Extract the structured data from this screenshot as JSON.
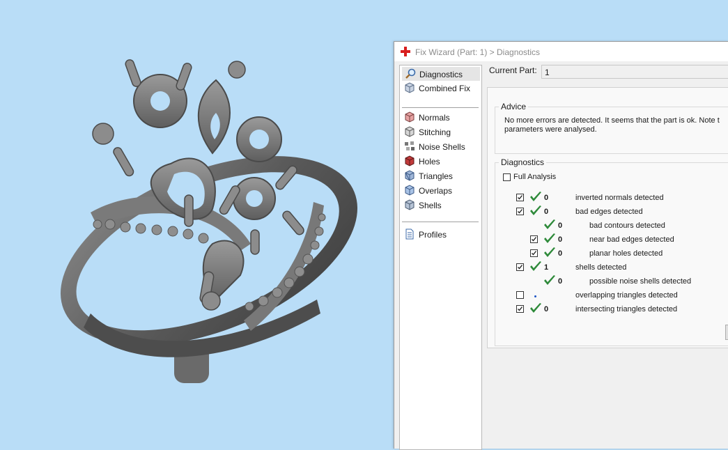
{
  "window": {
    "title": "Fix Wizard (Part: 1) > Diagnostics",
    "app_icon": "red-cross-icon"
  },
  "nav": {
    "items": [
      {
        "label": "Diagnostics",
        "icon": "magnifier-icon",
        "selected": true
      },
      {
        "label": "Combined Fix",
        "icon": "cube-icon"
      },
      {
        "label": "Normals",
        "icon": "normals-cube-icon"
      },
      {
        "label": "Stitching",
        "icon": "stitching-cube-icon"
      },
      {
        "label": "Noise Shells",
        "icon": "noise-shells-icon"
      },
      {
        "label": "Holes",
        "icon": "holes-cube-icon"
      },
      {
        "label": "Triangles",
        "icon": "triangles-cube-icon"
      },
      {
        "label": "Overlaps",
        "icon": "overlaps-cube-icon"
      },
      {
        "label": "Shells",
        "icon": "shells-cube-icon"
      },
      {
        "label": "Profiles",
        "icon": "document-icon"
      }
    ]
  },
  "current_part": {
    "label": "Current Part:",
    "value": "1"
  },
  "advice": {
    "legend": "Advice",
    "line1": "No more errors are detected. It seems that the part is ok. Note t",
    "line2": "parameters were analysed."
  },
  "diagnostics": {
    "legend": "Diagnostics",
    "full_analysis_label": "Full Analysis",
    "full_analysis_checked": false,
    "rows": [
      {
        "checkbox": true,
        "checked": true,
        "status": "ok",
        "count": "0",
        "label": "inverted normals detected",
        "indent": 0
      },
      {
        "checkbox": true,
        "checked": true,
        "status": "ok",
        "count": "0",
        "label": "bad edges detected",
        "indent": 0
      },
      {
        "checkbox": false,
        "checked": false,
        "status": "ok",
        "count": "0",
        "label": "bad contours detected",
        "indent": 1
      },
      {
        "checkbox": true,
        "checked": true,
        "status": "ok",
        "count": "0",
        "label": "near bad edges detected",
        "indent": 1
      },
      {
        "checkbox": true,
        "checked": true,
        "status": "ok",
        "count": "0",
        "label": "planar holes detected",
        "indent": 1
      },
      {
        "checkbox": true,
        "checked": true,
        "status": "ok",
        "count": "1",
        "label": "shells detected",
        "indent": 0
      },
      {
        "checkbox": false,
        "checked": false,
        "status": "ok",
        "count": "0",
        "label": "possible noise shells detected",
        "indent": 1
      },
      {
        "checkbox": true,
        "checked": false,
        "status": "unknown",
        "count": "",
        "label": "overlapping triangles detected",
        "indent": 0
      },
      {
        "checkbox": true,
        "checked": true,
        "status": "ok",
        "count": "0",
        "label": "intersecting triangles detected",
        "indent": 0
      }
    ]
  },
  "colors": {
    "viewport_bg": "#b9ddf7",
    "check_green": "#2e8a3a",
    "model_gray": "#6c6c6c"
  }
}
